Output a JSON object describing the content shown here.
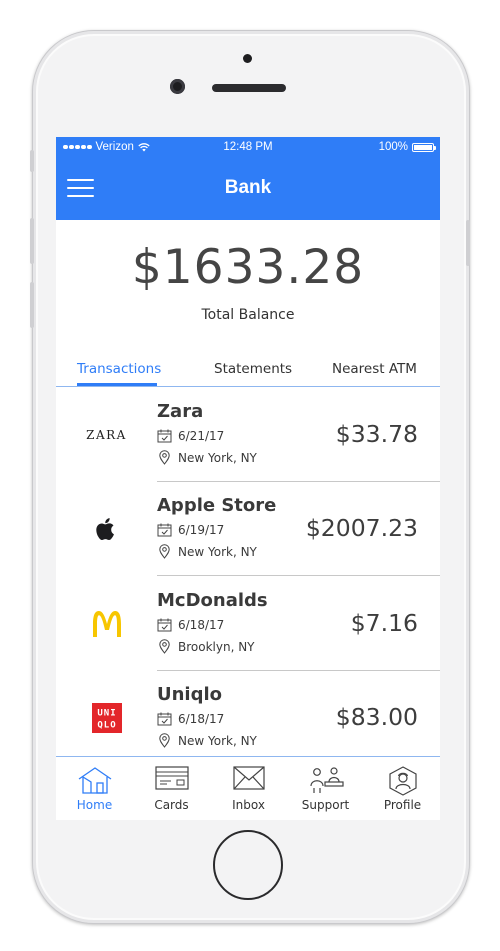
{
  "status_bar": {
    "carrier": "Verizon",
    "time": "12:48 PM",
    "battery": "100%"
  },
  "navbar": {
    "title": "Bank"
  },
  "balance": {
    "amount": "$1633.28",
    "label": "Total Balance"
  },
  "tabs": [
    {
      "label": "Transactions",
      "active": true
    },
    {
      "label": "Statements",
      "active": false
    },
    {
      "label": "Nearest ATM",
      "active": false
    }
  ],
  "transactions": [
    {
      "merchant": "Zara",
      "logo": "ZARA",
      "date": "6/21/17",
      "location": "New York, NY",
      "amount": "$33.78"
    },
    {
      "merchant": "Apple Store",
      "logo": "apple-logo",
      "date": "6/19/17",
      "location": "New York, NY",
      "amount": "$2007.23"
    },
    {
      "merchant": "McDonalds",
      "logo": "mcdonalds-logo",
      "date": "6/18/17",
      "location": "Brooklyn, NY",
      "amount": "$7.16"
    },
    {
      "merchant": "Uniqlo",
      "logo": "uniqlo-logo",
      "date": "6/18/17",
      "location": "New York, NY",
      "amount": "$83.00"
    }
  ],
  "tab_bar": [
    {
      "label": "Home",
      "icon": "home-icon",
      "active": true
    },
    {
      "label": "Cards",
      "icon": "card-icon",
      "active": false
    },
    {
      "label": "Inbox",
      "icon": "envelope-icon",
      "active": false
    },
    {
      "label": "Support",
      "icon": "support-icon",
      "active": false
    },
    {
      "label": "Profile",
      "icon": "profile-icon",
      "active": false
    }
  ],
  "colors": {
    "accent": "#2f7df7",
    "text": "#3a3a3a",
    "uniqlo_red": "#e3262a",
    "mcdonalds_yellow": "#f7c600"
  }
}
